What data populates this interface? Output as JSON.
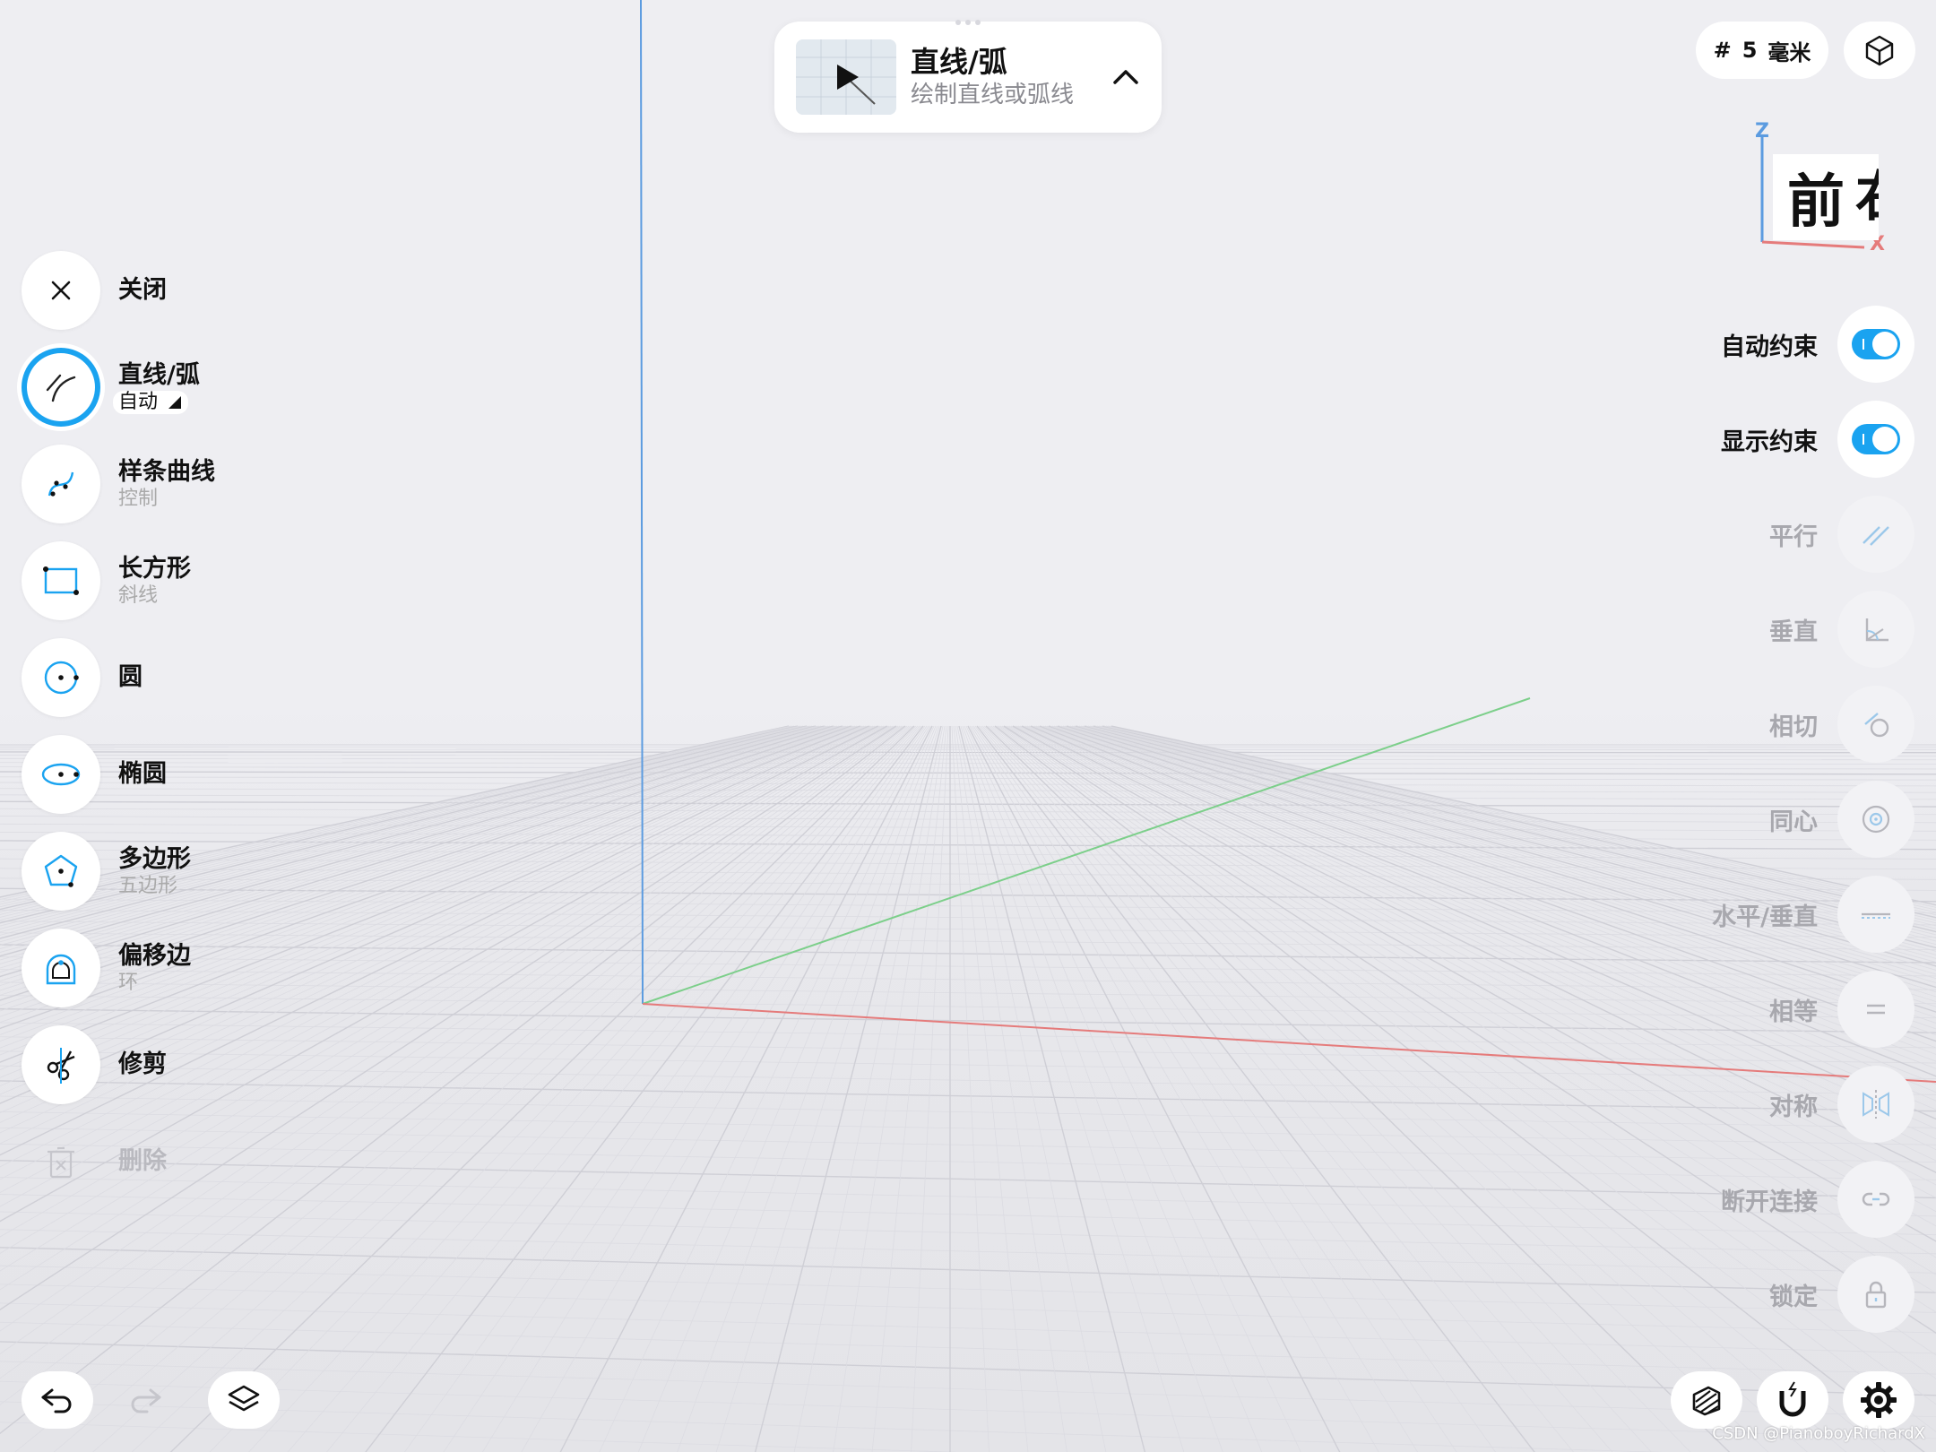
{
  "tools": [
    {
      "label": "关闭",
      "sub": "",
      "icon": "close-icon"
    },
    {
      "label": "直线/弧",
      "sub": "自动",
      "icon": "line-arc-icon",
      "active": true
    },
    {
      "label": "样条曲线",
      "sub": "控制",
      "icon": "spline-icon"
    },
    {
      "label": "长方形",
      "sub": "斜线",
      "icon": "rectangle-icon"
    },
    {
      "label": "圆",
      "sub": "",
      "icon": "circle-icon"
    },
    {
      "label": "椭圆",
      "sub": "",
      "icon": "ellipse-icon"
    },
    {
      "label": "多边形",
      "sub": "五边形",
      "icon": "polygon-icon"
    },
    {
      "label": "偏移边",
      "sub": "环",
      "icon": "offset-edge-icon"
    },
    {
      "label": "修剪",
      "sub": "",
      "icon": "trim-icon"
    },
    {
      "label": "删除",
      "sub": "",
      "icon": "delete-icon",
      "disabled": true
    }
  ],
  "card": {
    "title": "直线/弧",
    "subtitle": "绘制直线或弧线",
    "icons": [
      "play-icon",
      "chevron-up-icon"
    ]
  },
  "grid_unit": {
    "symbol": "#",
    "value": "5",
    "unit": "毫米"
  },
  "view_cube": {
    "front": "前",
    "side": "右",
    "axis_z": "Z",
    "axis_x": "X"
  },
  "constraints": [
    {
      "label": "自动约束",
      "type": "toggle",
      "on": true
    },
    {
      "label": "显示约束",
      "type": "toggle",
      "on": true
    },
    {
      "label": "平行",
      "icon": "parallel-icon",
      "disabled": true
    },
    {
      "label": "垂直",
      "icon": "perpendicular-icon",
      "disabled": true
    },
    {
      "label": "相切",
      "icon": "tangent-icon",
      "disabled": true
    },
    {
      "label": "同心",
      "icon": "concentric-icon",
      "disabled": true
    },
    {
      "label": "水平/垂直",
      "icon": "horizontal-vertical-icon",
      "disabled": true
    },
    {
      "label": "相等",
      "icon": "equal-icon",
      "disabled": true
    },
    {
      "label": "对称",
      "icon": "symmetric-icon",
      "disabled": true
    },
    {
      "label": "断开连接",
      "icon": "disconnect-icon",
      "disabled": true
    },
    {
      "label": "锁定",
      "icon": "lock-icon",
      "disabled": true
    }
  ],
  "bottom_left": [
    "undo-icon",
    "redo-icon",
    "layers-icon"
  ],
  "bottom_right": [
    "hatch-icon",
    "magnet-icon",
    "settings-icon"
  ],
  "watermark": "CSDN @PianoboyRichardX",
  "colors": {
    "accent": "#1aa3f0",
    "axis_x": "#e57b7b",
    "axis_y": "#7ccf8a",
    "axis_z": "#5b9be0"
  }
}
